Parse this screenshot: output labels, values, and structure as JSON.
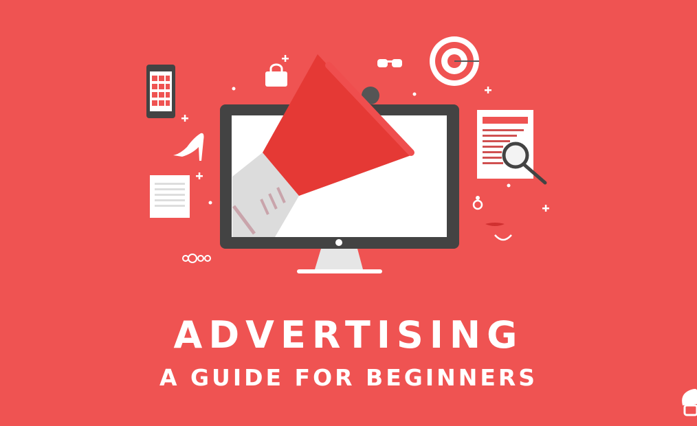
{
  "title": "ADVERTISING",
  "subtitle": "A GUIDE FOR BEGINNERS",
  "colors": {
    "background": "#EF5352",
    "megaphone": "#E53935",
    "monitor": "#434343",
    "white": "#FFFFFF"
  },
  "icons": [
    "megaphone-icon",
    "monitor-icon",
    "smartphone-icon",
    "handbag-icon",
    "sunglasses-icon",
    "target-icon",
    "document-icon",
    "magnifier-icon",
    "high-heel-icon",
    "notepad-icon",
    "ring-icon",
    "bracelet-icon",
    "mustache-icon",
    "logo-icon"
  ]
}
